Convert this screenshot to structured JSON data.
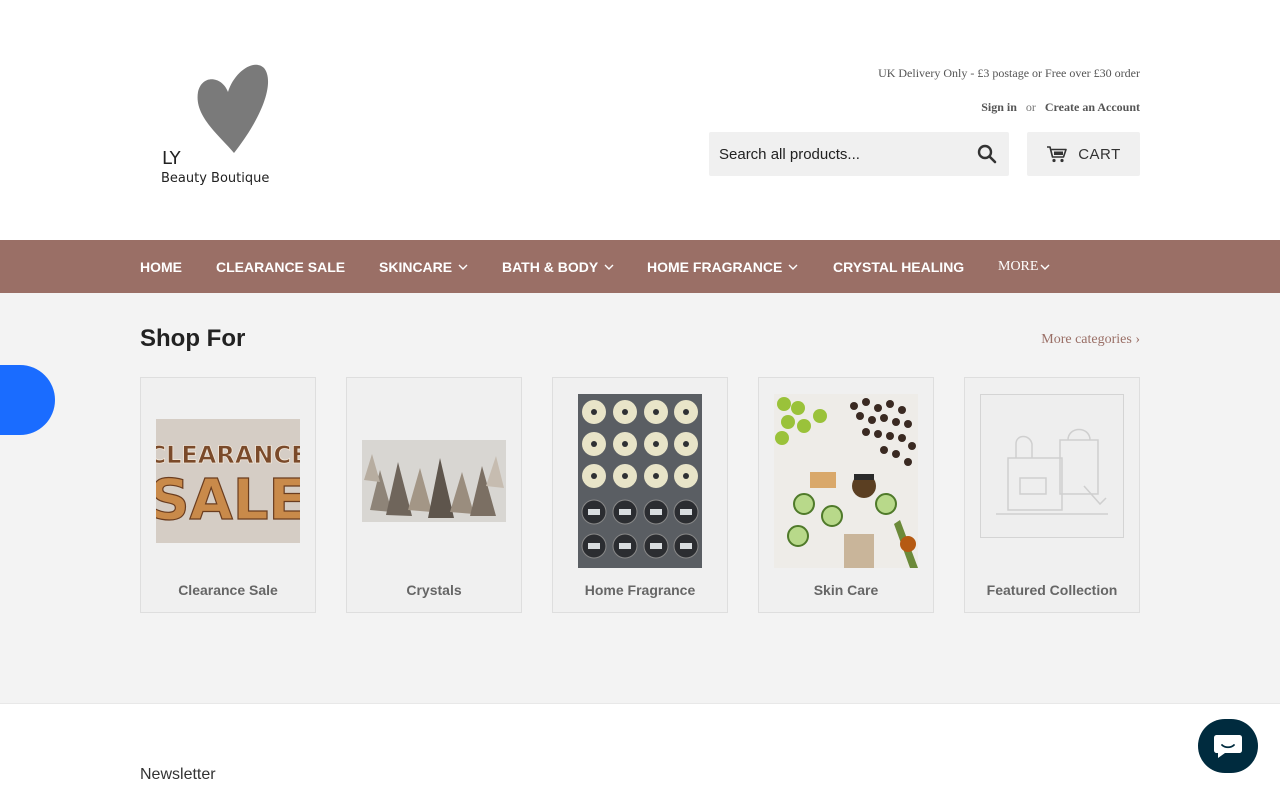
{
  "header": {
    "brand_initials": "LY",
    "brand_name": "Beauty Boutique",
    "delivery_notice": "UK Delivery Only - £3 postage or Free over £30 order",
    "sign_in": "Sign in",
    "or": "or",
    "create_account": "Create an Account",
    "search_placeholder": "Search all products...",
    "cart_label": "CART"
  },
  "nav": {
    "items": [
      {
        "label": "HOME"
      },
      {
        "label": "CLEARANCE SALE"
      },
      {
        "label": "SKINCARE"
      },
      {
        "label": "BATH & BODY"
      },
      {
        "label": "HOME FRAGRANCE"
      },
      {
        "label": "CRYSTAL HEALING"
      },
      {
        "label": "MORE"
      }
    ]
  },
  "main": {
    "title": "Shop For",
    "more_categories": "More categories ›",
    "cards": [
      {
        "label": "Clearance Sale",
        "image_text_1": "CLEARANCE",
        "image_text_2": "SALE"
      },
      {
        "label": "Crystals"
      },
      {
        "label": "Home Fragrance"
      },
      {
        "label": "Skin Care"
      },
      {
        "label": "Featured Collection"
      }
    ]
  },
  "footer": {
    "newsletter": "Newsletter"
  },
  "colors": {
    "nav_bg": "#9a6f66",
    "accent_link": "#9a6f66",
    "side_tab": "#1a6cff",
    "chat_bg": "#002b3e"
  },
  "icons": [
    "search-icon",
    "cart-icon",
    "chevron-down-icon",
    "chat-icon",
    "heart-logo"
  ]
}
